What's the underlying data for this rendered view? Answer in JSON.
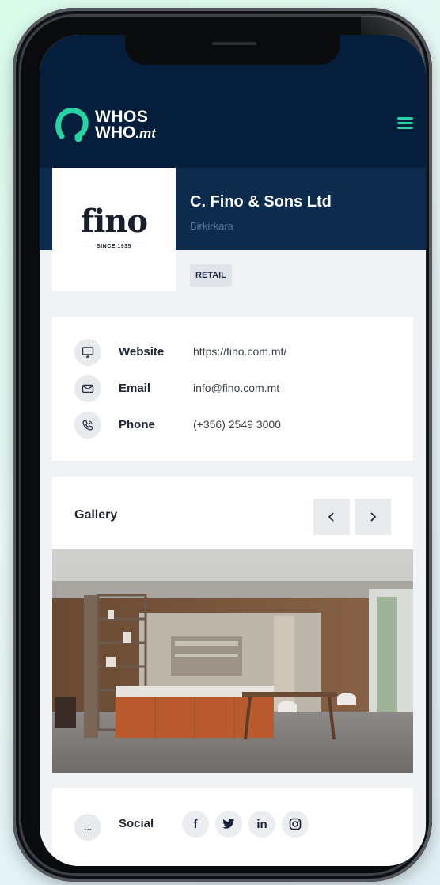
{
  "brand": {
    "line1": "WHOS",
    "line2": "WHO",
    "suffix": ".mt",
    "accent": "#25d4a5",
    "navy": "#041e3c"
  },
  "company": {
    "name": "C. Fino & Sons Ltd",
    "city": "Birkirkara",
    "tag": "RETAIL",
    "logo": {
      "word": "fino",
      "since": "SINCE 1935"
    }
  },
  "contact": {
    "website": {
      "label": "Website",
      "value": "https://fino.com.mt/",
      "icon": "monitor-icon"
    },
    "email": {
      "label": "Email",
      "value": "info@fino.com.mt",
      "icon": "envelope-icon"
    },
    "phone": {
      "label": "Phone",
      "value": "(+356) 2549 3000",
      "icon": "phone-icon"
    }
  },
  "gallery": {
    "title": "Gallery",
    "prev": "‹",
    "next": "›",
    "image": "kitchen-interior-photo"
  },
  "social": {
    "more": "...",
    "label": "Social",
    "links": [
      {
        "name": "facebook",
        "glyph": "f"
      },
      {
        "name": "twitter",
        "glyph": "twitter-bird-icon"
      },
      {
        "name": "linkedin",
        "glyph": "in"
      },
      {
        "name": "instagram",
        "glyph": "instagram-icon"
      }
    ]
  }
}
